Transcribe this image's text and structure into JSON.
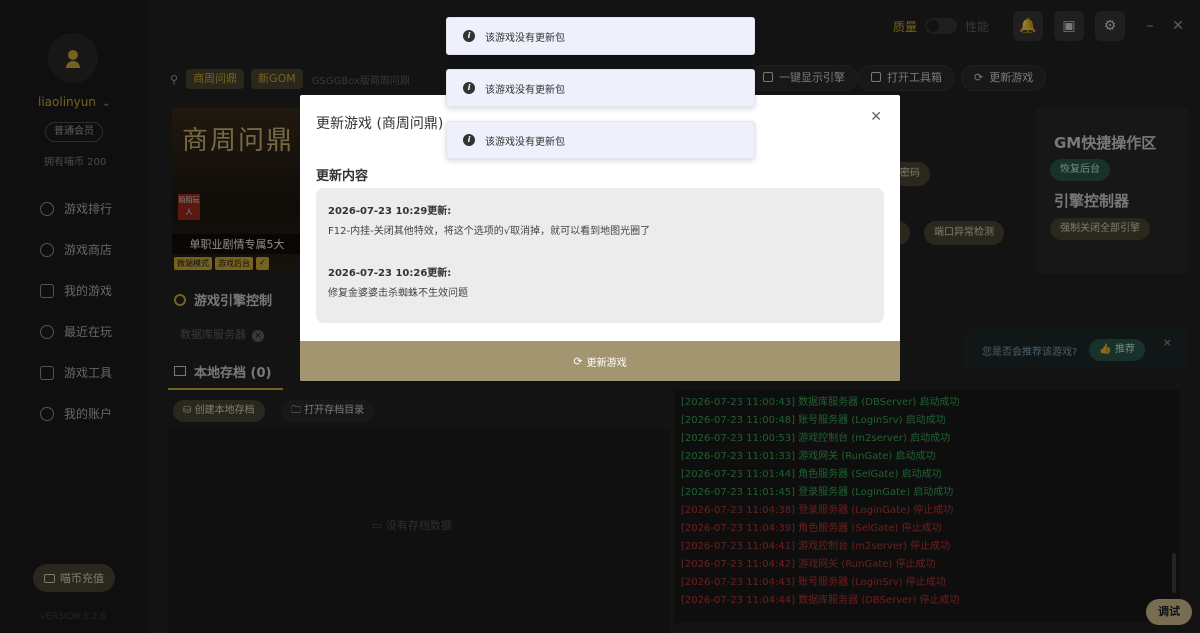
{
  "sidebar": {
    "username": "liaolinyun",
    "member": "普通会员",
    "coins": "拥有喵币 200",
    "items": [
      {
        "label": "游戏排行",
        "icon": "ranking-icon"
      },
      {
        "label": "游戏商店",
        "icon": "store-icon"
      },
      {
        "label": "我的游戏",
        "icon": "gamepad-icon"
      },
      {
        "label": "最近在玩",
        "icon": "compass-icon"
      },
      {
        "label": "游戏工具",
        "icon": "toolbox-icon"
      },
      {
        "label": "我的账户",
        "icon": "user-icon"
      }
    ],
    "recharge": "喵币充值",
    "version": "VERSION 5.2.6"
  },
  "topbar": {
    "quality": "质量",
    "performance": "性能"
  },
  "game": {
    "tag1": "商周问鼎",
    "tag2": "新GOM",
    "subtitle": "GSGGBox版商周问鼎",
    "btn_show_engine": "一键显示引擎",
    "btn_open_tools": "打开工具箱",
    "btn_update": "更新游戏"
  },
  "banner": {
    "title": "商周问鼎",
    "stamp": "陌陌玩人",
    "desc": "单职业剧情专属5大",
    "tags": [
      "微端模式",
      "游戏后台",
      "✓"
    ]
  },
  "engine": {
    "title": "游戏引擎控制",
    "db_label": "数据库服务器"
  },
  "storage": {
    "tab": "本地存档 (0)",
    "create": "创建本地存档",
    "open": "打开存档目录",
    "empty": "没有存档数据"
  },
  "gm": {
    "title": "GM快捷操作区",
    "btn_backend": "恢复后台",
    "engine_title": "引擎控制器",
    "btn_close_all": "强制关闭全部引擎"
  },
  "mid_buttons": {
    "password": "改密码",
    "detect_suffix": "测",
    "port_detect": "端口异常检测"
  },
  "recommend": {
    "text": "您是否会推荐该游戏?",
    "button": "推荐",
    "close": "×"
  },
  "logs": [
    {
      "text": "[2026-07-23 11:00:43] 数据库服务器 (DBServer) 启动成功",
      "status": "ok"
    },
    {
      "text": "[2026-07-23 11:00:48] 账号服务器 (LoginSrv) 启动成功",
      "status": "ok"
    },
    {
      "text": "[2026-07-23 11:00:53] 游戏控制台 (m2server) 启动成功",
      "status": "ok"
    },
    {
      "text": "[2026-07-23 11:01:33] 游戏网关 (RunGate) 启动成功",
      "status": "ok"
    },
    {
      "text": "[2026-07-23 11:01:44] 角色服务器 (SelGate) 启动成功",
      "status": "ok"
    },
    {
      "text": "[2026-07-23 11:01:45] 登录服务器 (LoginGate) 启动成功",
      "status": "ok"
    },
    {
      "text": "[2026-07-23 11:04:38] 登录服务器 (LoginGate) 停止成功",
      "status": "stop"
    },
    {
      "text": "[2026-07-23 11:04:39] 角色服务器 (SelGate) 停止成功",
      "status": "stop"
    },
    {
      "text": "[2026-07-23 11:04:41] 游戏控制台 (m2server) 停止成功",
      "status": "stop"
    },
    {
      "text": "[2026-07-23 11:04:42] 游戏网关 (RunGate) 停止成功",
      "status": "stop"
    },
    {
      "text": "[2026-07-23 11:04:43] 账号服务器 (LoginSrv) 停止成功",
      "status": "stop"
    },
    {
      "text": "[2026-07-23 11:04:44] 数据库服务器 (DBServer) 停止成功",
      "status": "stop"
    }
  ],
  "debug": "调试",
  "modal": {
    "title": "更新游戏 (商周问鼎)",
    "subtitle": "更新内容",
    "updates": [
      {
        "title": "2026-07-23 10:29更新:",
        "body": "F12-内挂-关闭其他特效，将这个选项的√取消掉，就可以看到地图光圈了"
      },
      {
        "title": "2026-07-23 10:26更新:",
        "body": "修复金婆婆击杀蜘蛛不生效问题"
      }
    ],
    "footer": "更新游戏"
  },
  "toasts": [
    "该游戏没有更新包",
    "该游戏没有更新包",
    "该游戏没有更新包"
  ]
}
